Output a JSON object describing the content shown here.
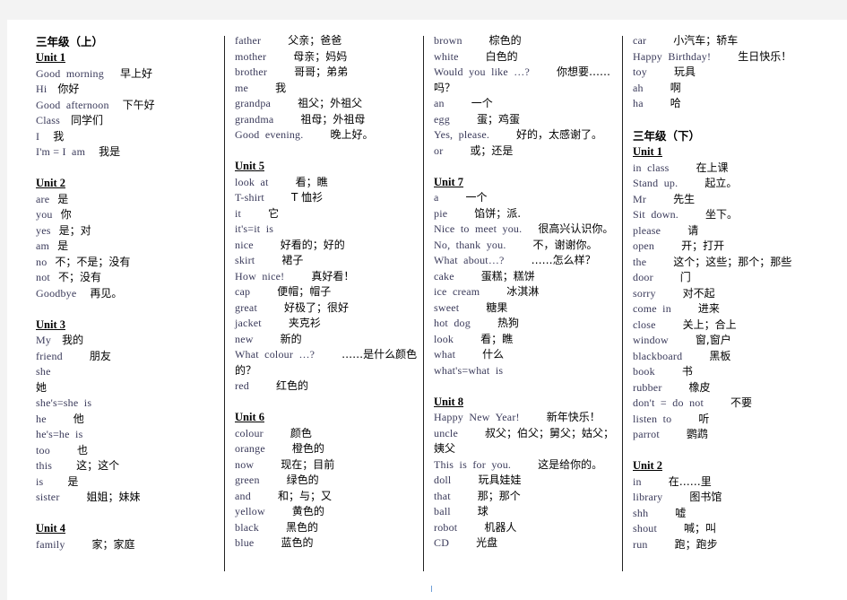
{
  "columns": [
    {
      "blocks": [
        {
          "type": "grade",
          "text": "三年级（上）"
        },
        {
          "type": "unit",
          "text": "Unit 1"
        },
        {
          "type": "entry",
          "en": "Good  morning",
          "pad": 4,
          "zh": "早上好"
        },
        {
          "type": "entry",
          "en": "Hi",
          "pad": 2,
          "zh": "你好"
        },
        {
          "type": "entry",
          "en": "Good  afternoon",
          "pad": 3,
          "zh": "下午好"
        },
        {
          "type": "entry",
          "en": "Class",
          "pad": 2,
          "zh": "同学们"
        },
        {
          "type": "entry",
          "en": "I",
          "pad": 3,
          "zh": "我"
        },
        {
          "type": "entry",
          "en": "I'm = I  am",
          "pad": 3,
          "zh": "我是"
        },
        {
          "type": "gap"
        },
        {
          "type": "unit",
          "text": "Unit 2"
        },
        {
          "type": "entry",
          "en": "are",
          "pad": 1,
          "zh": "是"
        },
        {
          "type": "entry",
          "en": "you",
          "pad": 1,
          "zh": "你"
        },
        {
          "type": "entry",
          "en": "yes",
          "pad": 1,
          "zh": "是；对"
        },
        {
          "type": "entry",
          "en": "am",
          "pad": 1,
          "zh": "是"
        },
        {
          "type": "entry",
          "en": "no",
          "pad": 1,
          "zh": "不；不是；没有"
        },
        {
          "type": "entry",
          "en": "not",
          "pad": 1,
          "zh": "不；没有"
        },
        {
          "type": "entry",
          "en": "Goodbye",
          "pad": 3,
          "zh": "再见。"
        },
        {
          "type": "gap"
        },
        {
          "type": "unit",
          "text": "Unit 3"
        },
        {
          "type": "entry",
          "en": "My",
          "pad": 2,
          "zh": "我的"
        },
        {
          "type": "entry",
          "en": "friend",
          "pad": 8,
          "zh": "朋友"
        },
        {
          "type": "entry",
          "en": "she",
          "pad": 0,
          "zh": ""
        },
        {
          "type": "entry",
          "en": "",
          "pad": 0,
          "zh": "她"
        },
        {
          "type": "entry",
          "en": "she's=she  is",
          "pad": 0,
          "zh": ""
        },
        {
          "type": "entry",
          "en": "he",
          "pad": 8,
          "zh": "他"
        },
        {
          "type": "entry",
          "en": "he's=he  is",
          "pad": 0,
          "zh": ""
        },
        {
          "type": "entry",
          "en": "too",
          "pad": 8,
          "zh": "也"
        },
        {
          "type": "entry",
          "en": "this",
          "pad": 7,
          "zh": "这；这个"
        },
        {
          "type": "entry",
          "en": "is",
          "pad": 7,
          "zh": "是"
        },
        {
          "type": "entry",
          "en": "sister",
          "pad": 8,
          "zh": "姐姐；妹妹"
        },
        {
          "type": "gap"
        },
        {
          "type": "unit",
          "text": "Unit 4"
        },
        {
          "type": "entry",
          "en": "family",
          "pad": 8,
          "zh": "家；家庭"
        }
      ]
    },
    {
      "blocks": [
        {
          "type": "entry",
          "en": "father",
          "pad": 8,
          "zh": "父亲；爸爸"
        },
        {
          "type": "entry",
          "en": "mother",
          "pad": 8,
          "zh": "母亲；妈妈"
        },
        {
          "type": "entry",
          "en": "brother",
          "pad": 8,
          "zh": "哥哥；弟弟"
        },
        {
          "type": "entry",
          "en": "me",
          "pad": 8,
          "zh": "我"
        },
        {
          "type": "entry",
          "en": "grandpa",
          "pad": 8,
          "zh": "祖父；外祖父"
        },
        {
          "type": "entry",
          "en": "grandma",
          "pad": 8,
          "zh": "祖母；外祖母"
        },
        {
          "type": "entry",
          "en": "Good  evening.",
          "pad": 8,
          "zh": "晚上好。"
        },
        {
          "type": "gap"
        },
        {
          "type": "unit",
          "text": "Unit 5"
        },
        {
          "type": "entry",
          "en": "look  at",
          "pad": 8,
          "zh": "看；瞧"
        },
        {
          "type": "entry",
          "en": "T-shirt",
          "pad": 8,
          "zh": "T  恤衫"
        },
        {
          "type": "entry",
          "en": "it",
          "pad": 8,
          "zh": "它"
        },
        {
          "type": "entry",
          "en": "it's=it  is",
          "pad": 0,
          "zh": ""
        },
        {
          "type": "entry",
          "en": "nice",
          "pad": 8,
          "zh": "好看的；好的"
        },
        {
          "type": "entry",
          "en": "skirt",
          "pad": 8,
          "zh": "裙子"
        },
        {
          "type": "entry",
          "en": "How  nice!",
          "pad": 8,
          "zh": "真好看！"
        },
        {
          "type": "entry",
          "en": "cap",
          "pad": 8,
          "zh": "便帽；帽子"
        },
        {
          "type": "entry",
          "en": "great",
          "pad": 8,
          "zh": "好极了；很好"
        },
        {
          "type": "entry",
          "en": "jacket",
          "pad": 8,
          "zh": "夹克衫"
        },
        {
          "type": "entry",
          "en": "new",
          "pad": 8,
          "zh": "新的"
        },
        {
          "type": "entry",
          "en": "What  colour  …?",
          "pad": 8,
          "zh": "……是什么颜色的？",
          "wrap": true
        },
        {
          "type": "entry",
          "en": "red",
          "pad": 8,
          "zh": "红色的"
        },
        {
          "type": "gap"
        },
        {
          "type": "unit",
          "text": "Unit 6"
        },
        {
          "type": "entry",
          "en": "colour",
          "pad": 8,
          "zh": "颜色"
        },
        {
          "type": "entry",
          "en": "orange",
          "pad": 8,
          "zh": "橙色的"
        },
        {
          "type": "entry",
          "en": "now",
          "pad": 8,
          "zh": "现在；目前"
        },
        {
          "type": "entry",
          "en": "green",
          "pad": 8,
          "zh": "绿色的"
        },
        {
          "type": "entry",
          "en": "and",
          "pad": 8,
          "zh": "和；与；又"
        },
        {
          "type": "entry",
          "en": "yellow",
          "pad": 8,
          "zh": "黄色的"
        },
        {
          "type": "entry",
          "en": "black",
          "pad": 8,
          "zh": "黑色的"
        },
        {
          "type": "entry",
          "en": "blue",
          "pad": 8,
          "zh": "蓝色的"
        }
      ]
    },
    {
      "blocks": [
        {
          "type": "entry",
          "en": "brown",
          "pad": 8,
          "zh": "棕色的"
        },
        {
          "type": "entry",
          "en": "white",
          "pad": 8,
          "zh": "白色的"
        },
        {
          "type": "entry",
          "en": "Would  you  like  …?",
          "pad": 8,
          "zh": "你想要……吗？",
          "wrap": true
        },
        {
          "type": "entry",
          "en": "an",
          "pad": 8,
          "zh": "一个"
        },
        {
          "type": "entry",
          "en": "egg",
          "pad": 8,
          "zh": "蛋；鸡蛋"
        },
        {
          "type": "entry",
          "en": "Yes,  please.",
          "pad": 8,
          "zh": "好的，太感谢了。"
        },
        {
          "type": "entry",
          "en": "or",
          "pad": 8,
          "zh": "或；还是"
        },
        {
          "type": "gap"
        },
        {
          "type": "unit",
          "text": "Unit 7"
        },
        {
          "type": "entry",
          "en": "a",
          "pad": 8,
          "zh": "一个"
        },
        {
          "type": "entry",
          "en": "pie",
          "pad": 8,
          "zh": "馅饼；派."
        },
        {
          "type": "entry",
          "en": "Nice  to  meet  you.",
          "pad": 4,
          "zh": "很高兴认识你。"
        },
        {
          "type": "entry",
          "en": "No,  thank  you.",
          "pad": 8,
          "zh": "不，谢谢你。"
        },
        {
          "type": "entry",
          "en": "What  about…?",
          "pad": 8,
          "zh": "……怎么样？"
        },
        {
          "type": "entry",
          "en": "cake",
          "pad": 8,
          "zh": "蛋糕；糕饼"
        },
        {
          "type": "entry",
          "en": "ice  cream",
          "pad": 8,
          "zh": "冰淇淋"
        },
        {
          "type": "entry",
          "en": "sweet",
          "pad": 8,
          "zh": "糖果"
        },
        {
          "type": "entry",
          "en": "hot  dog",
          "pad": 8,
          "zh": "热狗"
        },
        {
          "type": "entry",
          "en": "look",
          "pad": 8,
          "zh": "看；瞧"
        },
        {
          "type": "entry",
          "en": "what",
          "pad": 8,
          "zh": "什么"
        },
        {
          "type": "entry",
          "en": "what's=what  is",
          "pad": 0,
          "zh": ""
        },
        {
          "type": "gap"
        },
        {
          "type": "unit",
          "text": "Unit 8"
        },
        {
          "type": "entry",
          "en": "Happy  New  Year!",
          "pad": 8,
          "zh": "新年快乐！"
        },
        {
          "type": "entry",
          "en": "uncle",
          "pad": 8,
          "zh": "叔父；伯父；舅父；姑父；姨父",
          "wrap": true
        },
        {
          "type": "entry",
          "en": "This  is  for  you.",
          "pad": 8,
          "zh": "这是给你的。"
        },
        {
          "type": "entry",
          "en": "doll",
          "pad": 8,
          "zh": "玩具娃娃"
        },
        {
          "type": "entry",
          "en": "that",
          "pad": 8,
          "zh": "那；那个"
        },
        {
          "type": "entry",
          "en": "ball",
          "pad": 8,
          "zh": "球"
        },
        {
          "type": "entry",
          "en": "robot",
          "pad": 8,
          "zh": "机器人"
        },
        {
          "type": "entry",
          "en": "CD",
          "pad": 8,
          "zh": "光盘"
        }
      ]
    },
    {
      "blocks": [
        {
          "type": "entry",
          "en": "car",
          "pad": 8,
          "zh": "小汽车；轿车"
        },
        {
          "type": "entry",
          "en": "Happy  Birthday!",
          "pad": 8,
          "zh": "生日快乐！"
        },
        {
          "type": "entry",
          "en": "toy",
          "pad": 8,
          "zh": "玩具"
        },
        {
          "type": "entry",
          "en": "ah",
          "pad": 8,
          "zh": "啊"
        },
        {
          "type": "entry",
          "en": "ha",
          "pad": 8,
          "zh": "哈"
        },
        {
          "type": "gap"
        },
        {
          "type": "grade",
          "text": "三年级（下）"
        },
        {
          "type": "unit",
          "text": "Unit 1"
        },
        {
          "type": "entry",
          "en": "in  class",
          "pad": 8,
          "zh": "在上课"
        },
        {
          "type": "entry",
          "en": "Stand  up.",
          "pad": 8,
          "zh": "起立。"
        },
        {
          "type": "entry",
          "en": "Mr",
          "pad": 8,
          "zh": "先生"
        },
        {
          "type": "entry",
          "en": "Sit  down.",
          "pad": 8,
          "zh": "坐下。"
        },
        {
          "type": "entry",
          "en": "please",
          "pad": 8,
          "zh": "请"
        },
        {
          "type": "entry",
          "en": "open",
          "pad": 8,
          "zh": "开；打开"
        },
        {
          "type": "entry",
          "en": "the",
          "pad": 8,
          "zh": "这个；这些；那个；那些"
        },
        {
          "type": "entry",
          "en": "door",
          "pad": 8,
          "zh": "门"
        },
        {
          "type": "entry",
          "en": "sorry",
          "pad": 8,
          "zh": "对不起"
        },
        {
          "type": "entry",
          "en": "come  in",
          "pad": 8,
          "zh": "进来"
        },
        {
          "type": "entry",
          "en": "close",
          "pad": 8,
          "zh": "关上；合上"
        },
        {
          "type": "entry",
          "en": "window",
          "pad": 8,
          "zh": "窗,窗户"
        },
        {
          "type": "entry",
          "en": "blackboard",
          "pad": 8,
          "zh": "黑板"
        },
        {
          "type": "entry",
          "en": "book",
          "pad": 8,
          "zh": "书"
        },
        {
          "type": "entry",
          "en": "rubber",
          "pad": 8,
          "zh": "橡皮"
        },
        {
          "type": "entry",
          "en": "don't  =  do  not",
          "pad": 8,
          "zh": "不要"
        },
        {
          "type": "entry",
          "en": "listen  to",
          "pad": 8,
          "zh": "听"
        },
        {
          "type": "entry",
          "en": "parrot",
          "pad": 8,
          "zh": "鹦鹉"
        },
        {
          "type": "gap"
        },
        {
          "type": "unit",
          "text": "Unit 2"
        },
        {
          "type": "entry",
          "en": "in",
          "pad": 8,
          "zh": "在……里"
        },
        {
          "type": "entry",
          "en": "library",
          "pad": 8,
          "zh": "图书馆"
        },
        {
          "type": "entry",
          "en": "shh",
          "pad": 8,
          "zh": "嘘"
        },
        {
          "type": "entry",
          "en": "shout",
          "pad": 8,
          "zh": "喊；叫"
        },
        {
          "type": "entry",
          "en": "run",
          "pad": 8,
          "zh": "跑；跑步"
        }
      ]
    }
  ],
  "page_number": "1"
}
